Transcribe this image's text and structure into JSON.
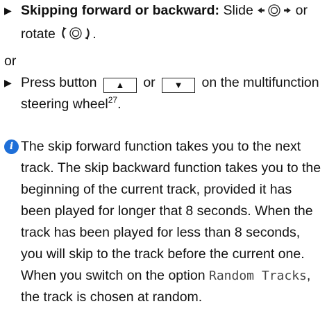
{
  "step1": {
    "bullet": "▶",
    "label": "Skipping forward or backward:",
    "text_a": " Slide ",
    "text_b": " or rotate ",
    "text_c": ".",
    "slide_icon": "slide-left-right-controller-icon",
    "rotate_icon": "rotate-controller-icon"
  },
  "or_text": "or",
  "step2": {
    "bullet": "▶",
    "text_a": "Press button ",
    "btn_up": "▲",
    "text_or": " or ",
    "btn_down": "▼",
    "text_b": " on the multifunction steering wheel",
    "footnote": "27",
    "text_c": "."
  },
  "info": {
    "icon": "info-icon",
    "icon_glyph": "i",
    "text_a": "The skip forward function takes you to the next track. The skip backward function takes you to the beginning of the current track, provided it has been played for longer that 8 seconds. When the track has been played for less than 8 seconds, you will skip to the track before the current one. When you switch on the option ",
    "option": "Random Tracks",
    "text_b": ", the track is chosen at random."
  }
}
